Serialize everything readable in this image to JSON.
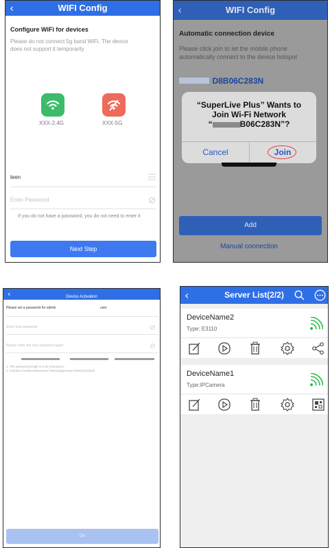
{
  "p1": {
    "title": "WIFI Config",
    "heading": "Configure WiFi for devices",
    "desc1": "Please do not connect 5g band WiFi. The device",
    "desc2": "does not support it temporarily",
    "band1": "XXX-2.4G",
    "band2": "XXX-5G",
    "ssid": "leen",
    "password_placeholder": "Enter Password",
    "hint": "If you do not have a password, you do not need to enter it",
    "next": "Next Step",
    "colors": {
      "band1": "#3dbb6b",
      "band2": "#ee6a5a",
      "accent": "#3f79f0"
    }
  },
  "p2": {
    "title": "WIFI Config",
    "heading": "Automatic connection device",
    "desc1": "Please click join to let the mobile phone",
    "desc2": "automatically connect to the device hotspot",
    "ssid_suffix": "D8B06C283N",
    "dialog_line1": "“SuperLive Plus” Wants to",
    "dialog_line2": "Join Wi-Fi Network",
    "dialog_line3_suffix": "B06C283N”?",
    "cancel": "Cancel",
    "join": "Join",
    "add": "Add",
    "manual": "Manual connection"
  },
  "p3": {
    "title": "Device Activation",
    "label": "Please set a password for admin",
    "user": "user",
    "new_pw_placeholder": "Enter new password",
    "confirm_pw_placeholder": "Please enter the new password again",
    "rule1": "1. The password length is 8-16 characters.",
    "rule2": "2. contains numbers/lowercase letters/uppercase letters/symbols.",
    "ok": "OK"
  },
  "p4": {
    "title": "Server List(2/2)",
    "devices": [
      {
        "name": "DeviceName2",
        "type": "Type: E3110"
      },
      {
        "name": "DeviceName1",
        "type": "Type:IPCamera"
      }
    ]
  }
}
